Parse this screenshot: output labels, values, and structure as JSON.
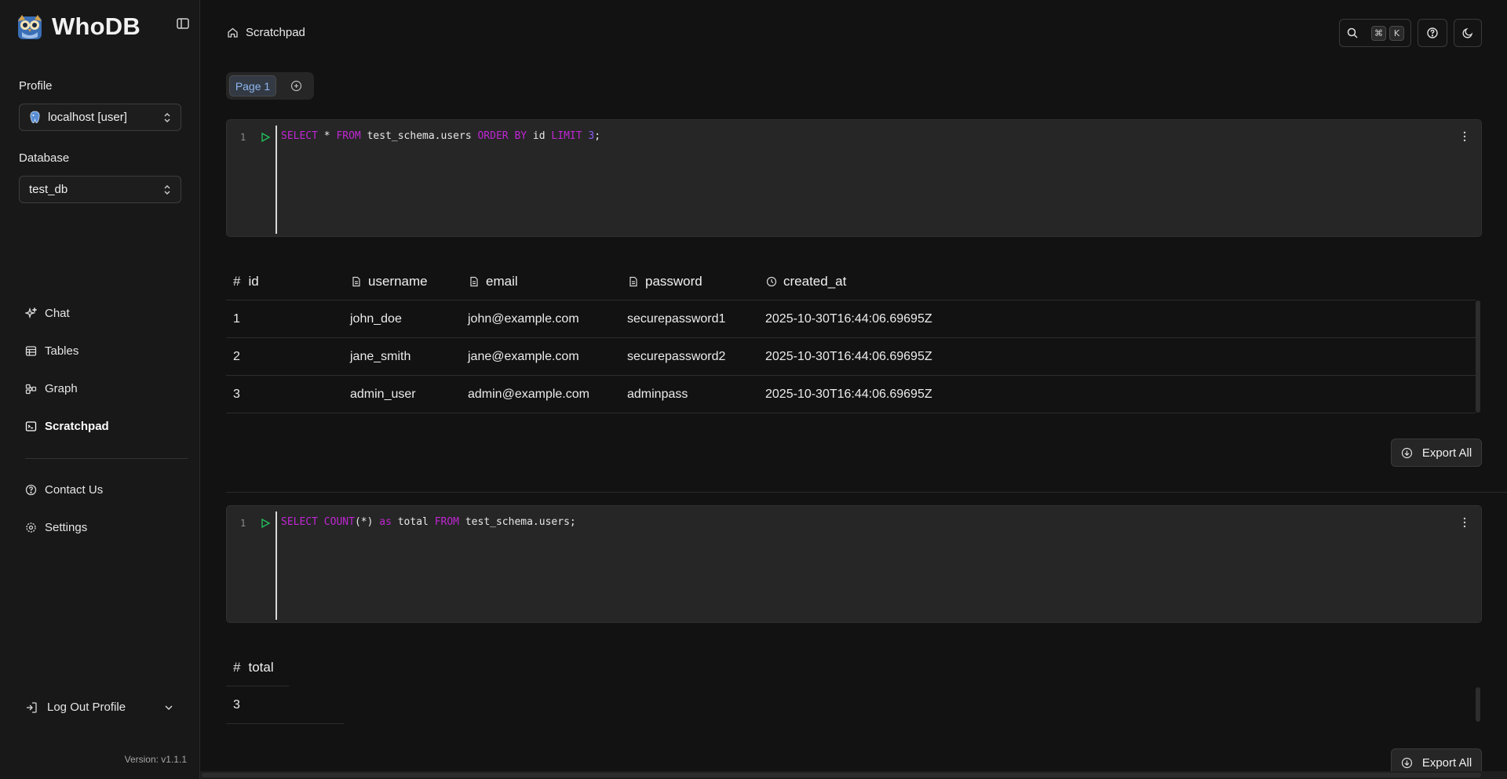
{
  "app": {
    "name": "WhoDB",
    "version": "Version: v1.1.1"
  },
  "sidebar": {
    "profile_label": "Profile",
    "profile_value": "localhost [user]",
    "database_label": "Database",
    "database_value": "test_db",
    "nav": [
      {
        "label": "Chat",
        "icon": "sparkles-icon"
      },
      {
        "label": "Tables",
        "icon": "table-icon"
      },
      {
        "label": "Graph",
        "icon": "graph-icon"
      },
      {
        "label": "Scratchpad",
        "icon": "terminal-icon",
        "active": true
      }
    ],
    "secondary_nav": [
      {
        "label": "Contact Us",
        "icon": "help-icon"
      },
      {
        "label": "Settings",
        "icon": "gear-icon"
      }
    ],
    "logout_label": "Log Out Profile"
  },
  "header": {
    "breadcrumb": "Scratchpad",
    "shortcut_keys": [
      "⌘",
      "K"
    ]
  },
  "pages": {
    "tabs": [
      {
        "label": "Page 1",
        "active": true
      }
    ]
  },
  "cells": [
    {
      "line_number": "1",
      "query_tokens": [
        {
          "t": "SELECT",
          "k": "kw"
        },
        {
          "t": " * ",
          "k": ""
        },
        {
          "t": "FROM",
          "k": "kw"
        },
        {
          "t": " test_schema.users ",
          "k": ""
        },
        {
          "t": "ORDER BY",
          "k": "kw"
        },
        {
          "t": " id ",
          "k": ""
        },
        {
          "t": "LIMIT",
          "k": "kw"
        },
        {
          "t": " ",
          "k": ""
        },
        {
          "t": "3",
          "k": "num"
        },
        {
          "t": ";",
          "k": ""
        }
      ],
      "result": {
        "columns": [
          {
            "name": "id",
            "type": "hash"
          },
          {
            "name": "username",
            "type": "text"
          },
          {
            "name": "email",
            "type": "text"
          },
          {
            "name": "password",
            "type": "text"
          },
          {
            "name": "created_at",
            "type": "time"
          }
        ],
        "rows": [
          [
            "1",
            "john_doe",
            "john@example.com",
            "securepassword1",
            "2025-10-30T16:44:06.69695Z"
          ],
          [
            "2",
            "jane_smith",
            "jane@example.com",
            "securepassword2",
            "2025-10-30T16:44:06.69695Z"
          ],
          [
            "3",
            "admin_user",
            "admin@example.com",
            "adminpass",
            "2025-10-30T16:44:06.69695Z"
          ]
        ]
      },
      "export_label": "Export All"
    },
    {
      "line_number": "1",
      "query_tokens": [
        {
          "t": "SELECT",
          "k": "kw"
        },
        {
          "t": " ",
          "k": ""
        },
        {
          "t": "COUNT",
          "k": "kw"
        },
        {
          "t": "(*) ",
          "k": ""
        },
        {
          "t": "as",
          "k": "kw"
        },
        {
          "t": " total ",
          "k": ""
        },
        {
          "t": "FROM",
          "k": "kw"
        },
        {
          "t": " test_schema.users;",
          "k": ""
        }
      ],
      "result": {
        "columns": [
          {
            "name": "total",
            "type": "hash"
          }
        ],
        "rows": [
          [
            "3"
          ]
        ]
      },
      "export_label": "Export All"
    }
  ],
  "colors": {
    "background": "#121212",
    "sidebar": "#181818",
    "editor": "#262626",
    "keyword": "#c026d3",
    "number": "#8b5cf6",
    "run": "#22c55e",
    "active_tab_text": "#8fb6f0"
  }
}
